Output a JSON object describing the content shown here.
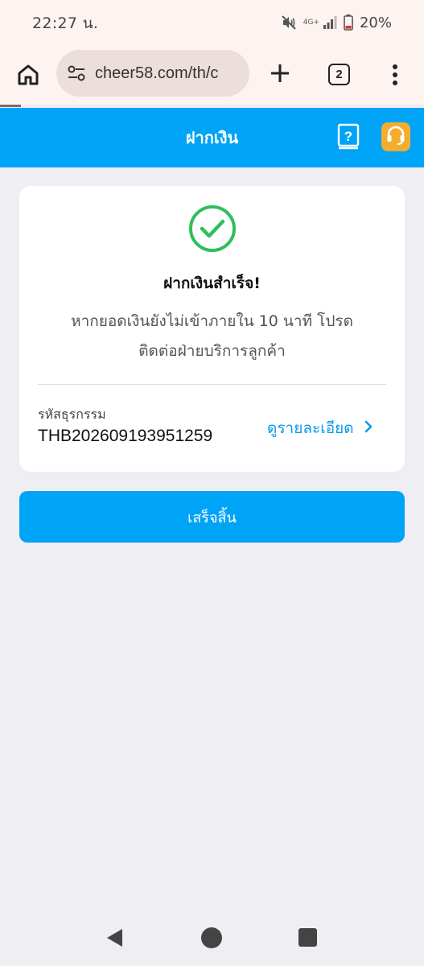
{
  "status_bar": {
    "time": "22:27 น.",
    "network": "4G+",
    "battery": "20%",
    "icons": [
      "mute-icon",
      "signal-icon",
      "battery-icon"
    ]
  },
  "browser": {
    "url": "cheer58.com/th/c",
    "tab_count": "2",
    "icons": [
      "home-icon",
      "site-settings-icon",
      "plus-icon",
      "more-vert-icon"
    ]
  },
  "header": {
    "title": "ฝากเงิน",
    "accent_color": "#00a4f6",
    "support_color": "#f5ad2e",
    "icons": [
      "help-book-icon",
      "headset-icon"
    ]
  },
  "card": {
    "status_icon": "check-circle-icon",
    "status_color": "#2fbf5a",
    "title": "ฝากเงินสำเร็จ!",
    "message_line1": "หากยอดเงินยังไม่เข้าภายใน 10 นาที โปรด",
    "message_line2": "ติดต่อฝ่ายบริการลูกค้า",
    "transaction_label": "รหัสธุรกรรม",
    "transaction_id": "THB202609193951259",
    "detail_link": "ดูรายละเอียด"
  },
  "done_button": "เสร็จสิ้น",
  "nav": {
    "icons": [
      "back-icon",
      "home-circle-icon",
      "recents-icon"
    ]
  }
}
